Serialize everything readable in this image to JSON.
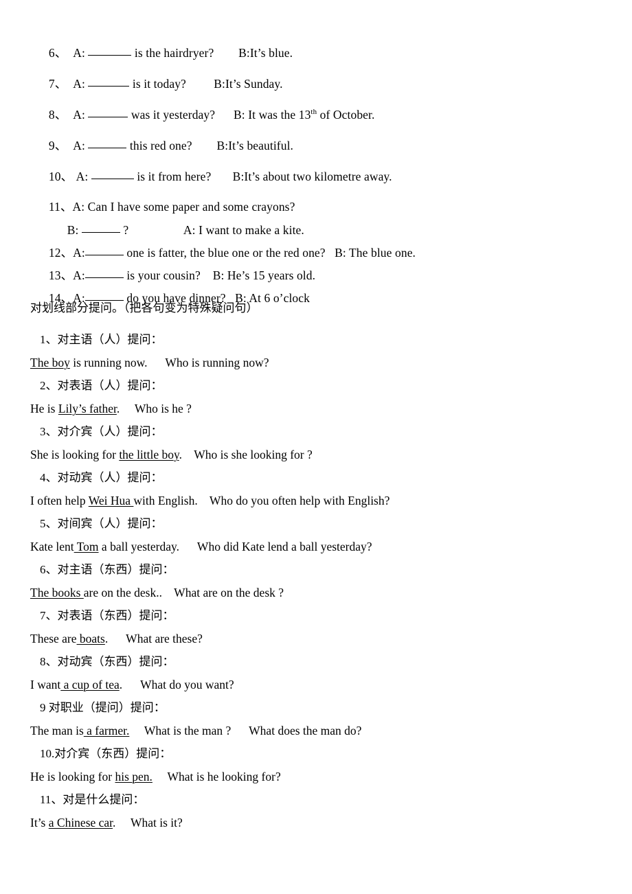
{
  "document": {
    "fill_in_questions": [
      {
        "number": "6、",
        "pre": "A:",
        "blank_width": "w1",
        "mid": " is the hairdryer?",
        "gap": "        ",
        "answer": "B:It’s blue."
      },
      {
        "number": "7、",
        "pre": "A:",
        "blank_width": "w2",
        "mid": " is it today?",
        "gap": "         ",
        "answer": "B:It’s Sunday."
      },
      {
        "number": "8、",
        "pre": "A:",
        "blank_width": "w3",
        "mid": " was it yesterday?",
        "gap": "      ",
        "answer_pre": "B: It was the 13",
        "answer_sup": "th",
        "answer_post": " of October."
      },
      {
        "number": "9、",
        "pre": "A:",
        "blank_width": "w4",
        "mid": " this red one?",
        "gap": "        ",
        "answer": "B:It’s beautiful."
      },
      {
        "number": "10、",
        "pre": "A:",
        "blank_width": "w5",
        "mid": " is it from here?",
        "gap": "       ",
        "answer": "B:It’s about two kilometre away."
      }
    ],
    "question_11": {
      "line_a": "11、A: Can I have some paper and some crayons?",
      "line_b_pre": "B:",
      "line_b_blank": "w4",
      "line_b_mid": " ?",
      "line_b_gap": "                  ",
      "line_b_answer": "A: I want to make a kite."
    },
    "question_12": {
      "number": "12、",
      "pre": "A:",
      "blank_width": "w4",
      "mid": " one is fatter, the blue one or the red one?",
      "gap": "   ",
      "answer": "B: The blue one."
    },
    "question_13": {
      "number": "13、",
      "pre": "A:",
      "blank_width": "w4",
      "mid": " is your cousin?",
      "gap": "    ",
      "answer": "B: He’s 15 years old."
    },
    "question_14": {
      "number": "14、",
      "pre": "A:",
      "blank_width": "w4",
      "mid": " do you have dinner?",
      "gap": "   ",
      "answer": "B: At 6 o’clock"
    },
    "section_heading": "对划线部分提问。（把各句变为特殊疑问句）",
    "transform_items": [
      {
        "label": "1、对主语（人）提问：",
        "sentence_pre": "",
        "underlined": "The boy",
        "sentence_post": " is running now.",
        "gap": "      ",
        "question": "Who is running now?"
      },
      {
        "label": "2、对表语（人）提问：",
        "sentence_pre": "He is ",
        "underlined": "Lily’s father",
        "sentence_post": ".",
        "gap": "     ",
        "question": "Who is he ?"
      },
      {
        "label": "3、对介宾（人）提问：",
        "sentence_pre": "She is looking for ",
        "underlined": "the little boy",
        "sentence_post": ".",
        "gap": "    ",
        "question": "Who is she looking for ?"
      },
      {
        "label": "4、对动宾（人）提问：",
        "sentence_pre": "I often help ",
        "underlined": "Wei Hua ",
        "sentence_post": "with English.",
        "gap": "    ",
        "question": "Who do you often help with English?"
      },
      {
        "label": "5、对间宾（人）提问：",
        "sentence_pre": "Kate lent",
        "underlined": " Tom",
        "sentence_post": " a ball yesterday.",
        "gap": "      ",
        "question": "Who did Kate lend a ball yesterday?"
      },
      {
        "label": "6、对主语（东西）提问：",
        "sentence_pre": "",
        "underlined": "The books ",
        "sentence_post": "are on the desk..",
        "gap": "    ",
        "question": "What are on the desk ?"
      },
      {
        "label": "7、对表语（东西）提问：",
        "sentence_pre": "These are",
        "underlined": " boats",
        "sentence_post": ".",
        "gap": "      ",
        "question": "What are these?"
      },
      {
        "label": "8、对动宾（东西）提问：",
        "sentence_pre": "I want",
        "underlined": " a cup of tea",
        "sentence_post": ".",
        "gap": "      ",
        "question": "What do you want?"
      },
      {
        "label": "9 对职业（提问）提问：",
        "sentence_pre": "The man is",
        "underlined": " a farmer.",
        "sentence_post": "",
        "gap": "     ",
        "question": "What is the man ?      What does the man do?"
      },
      {
        "label": "10.对介宾（东西）提问：",
        "sentence_pre": "He is looking for ",
        "underlined": "his pen.",
        "sentence_post": "",
        "gap": "     ",
        "question": "What is he looking for?"
      },
      {
        "label": "11、对是什么提问：",
        "sentence_pre": "It’s ",
        "underlined": "a Chinese car",
        "sentence_post": ".",
        "gap": "     ",
        "question": "What is it?"
      }
    ]
  }
}
